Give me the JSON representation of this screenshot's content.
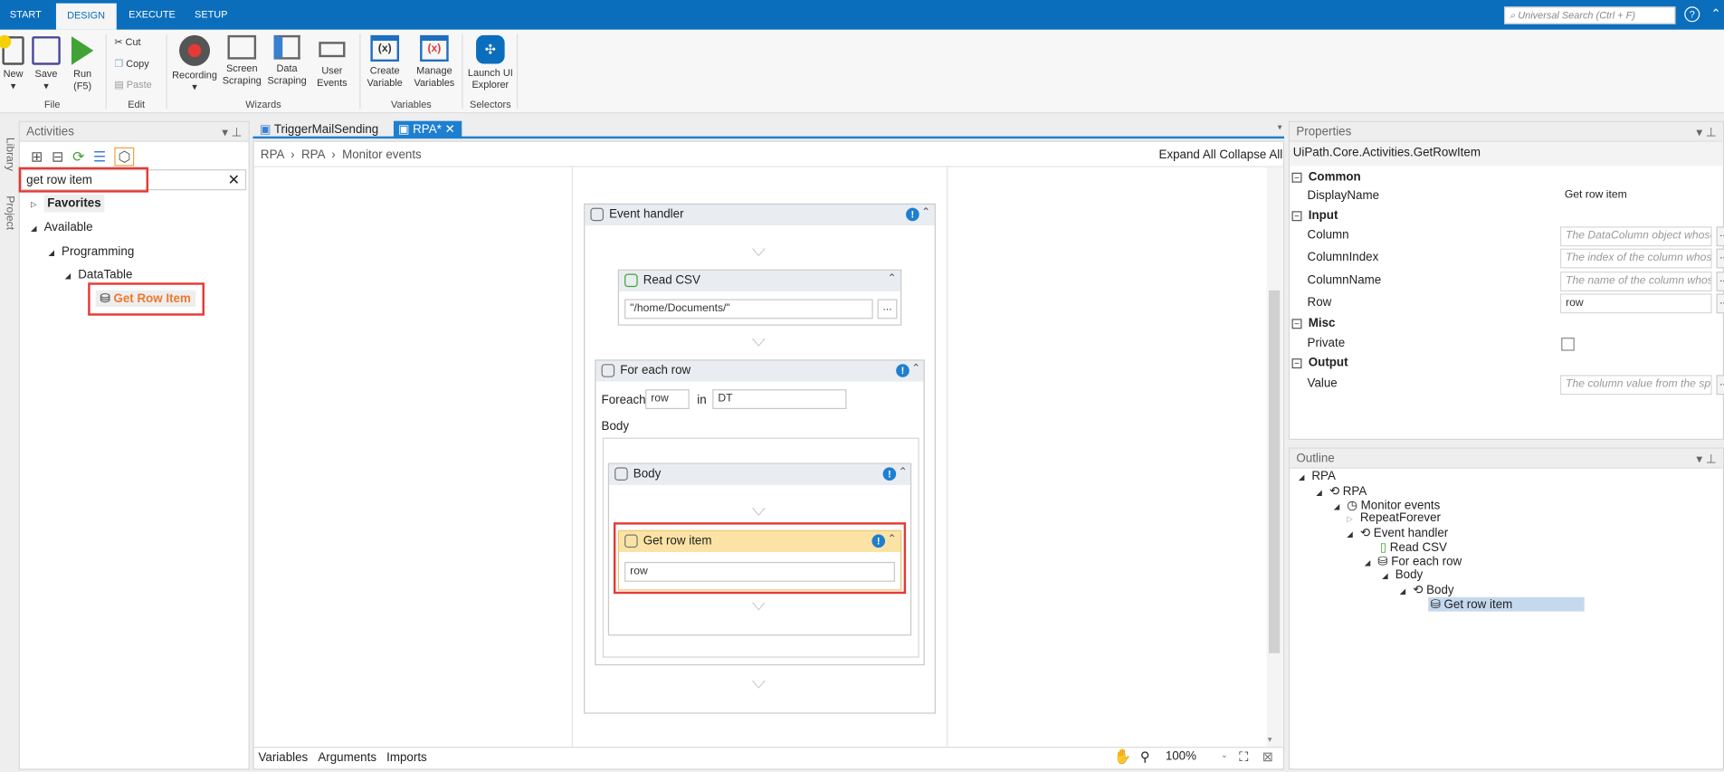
{
  "ribbon": {
    "tabs": [
      "START",
      "DESIGN",
      "EXECUTE",
      "SETUP"
    ],
    "search_placeholder": "Universal Search (Ctrl + F)",
    "help": "?",
    "buttons": {
      "new": "New",
      "save": "Save",
      "run": "Run\n(F5)",
      "cut": "Cut",
      "copy": "Copy",
      "paste": "Paste",
      "recording": "Recording",
      "screen_scraping": "Screen Scraping",
      "data_scraping": "Data Scraping",
      "user_events": "User Events",
      "create_variable": "Create Variable",
      "manage_variables": "Manage Variables",
      "launch_ui_explorer": "Launch UI Explorer"
    },
    "groups": [
      "File",
      "Edit",
      "Wizards",
      "Variables",
      "Selectors"
    ]
  },
  "side_strip": [
    "Library",
    "Project"
  ],
  "activities": {
    "title": "Activities",
    "search_value": "get row item",
    "tree": {
      "favorites": "Favorites",
      "available": "Available",
      "programming": "Programming",
      "datatable": "DataTable",
      "item": "Get Row Item"
    }
  },
  "designer": {
    "tabs": [
      "TriggerMailSending",
      "RPA*"
    ],
    "breadcrumb": [
      "RPA",
      "RPA",
      "Monitor events"
    ],
    "expand_all": "Expand All",
    "collapse_all": "Collapse All",
    "event_handler": "Event handler",
    "read_csv": "Read CSV",
    "read_csv_path": "\"/home/Documents/\"",
    "for_each": "For each row",
    "foreach_label": "Foreach",
    "foreach_var": "row",
    "in_label": "in",
    "foreach_src": "DT",
    "body_label": "Body",
    "body": "Body",
    "get_row_item": "Get row item",
    "get_row_value": "row",
    "dots": "...",
    "bottom_tabs": [
      "Variables",
      "Arguments",
      "Imports"
    ],
    "zoom": "100%"
  },
  "properties": {
    "title": "Properties",
    "type": "UiPath.Core.Activities.GetRowItem",
    "common": "Common",
    "display_name_k": "DisplayName",
    "display_name_v": "Get row item",
    "input": "Input",
    "column_k": "Column",
    "column_v": "The DataColumn object whose",
    "colindex_k": "ColumnIndex",
    "colindex_v": "The index of the column whose",
    "colname_k": "ColumnName",
    "colname_v": "The name of the column whose",
    "row_k": "Row",
    "row_v": "row",
    "misc": "Misc",
    "private_k": "Private",
    "output": "Output",
    "value_k": "Value",
    "value_v": "The column value from the specified"
  },
  "outline": {
    "title": "Outline",
    "items": [
      "RPA",
      "RPA",
      "Monitor events",
      "RepeatForever",
      "Event handler",
      "Read CSV",
      "For each row",
      "Body",
      "Body",
      "Get row item"
    ]
  },
  "colors": {
    "accent": "#0a6ebd",
    "highlight": "#e53935",
    "orange": "#f0782d"
  }
}
